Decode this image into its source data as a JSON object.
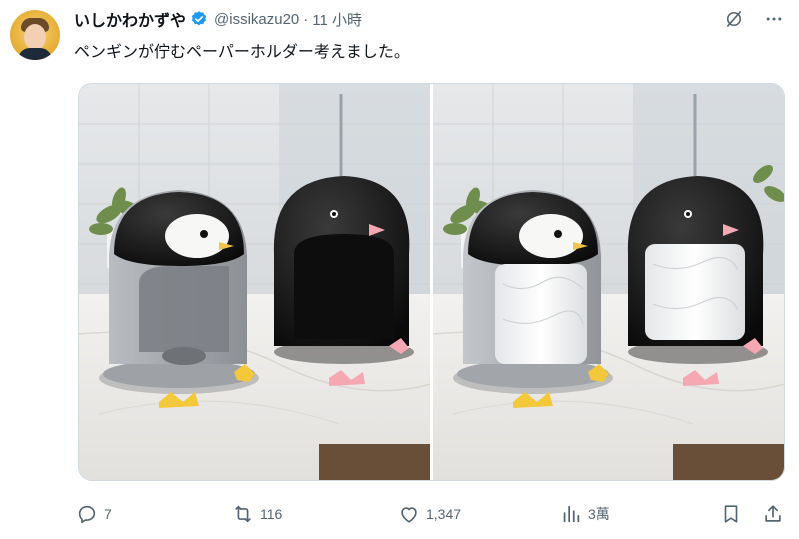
{
  "tweet": {
    "author_name": "いしかわかずや",
    "handle": "@issikazu20",
    "separator": "·",
    "time": "11 小時",
    "text": "ペンギンが佇むペーパーホルダー考えました。"
  },
  "icons": {
    "verified": "verified-badge-icon",
    "grok": "grok-icon",
    "more": "more-icon"
  },
  "media": {
    "photo_count": 2
  },
  "actions": {
    "reply_count": "7",
    "retweet_count": "116",
    "like_count": "1,347",
    "views_count": "3萬"
  },
  "colors": {
    "verified_blue": "#1d9bf0",
    "secondary_text": "#536471",
    "border": "#cfd9de"
  }
}
